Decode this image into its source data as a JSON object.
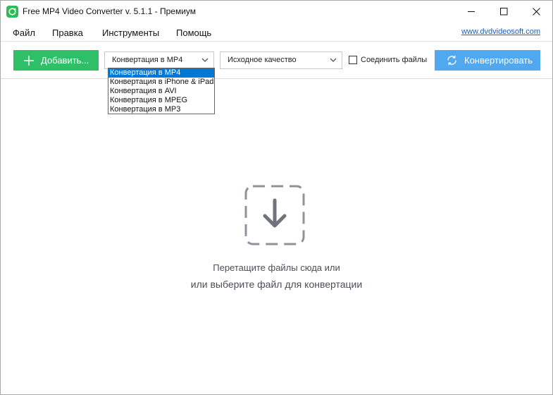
{
  "window": {
    "title": "Free MP4 Video Converter v. 5.1.1 - Премиум"
  },
  "menu": {
    "items": [
      "Файл",
      "Правка",
      "Инструменты",
      "Помощь"
    ],
    "site_link": "www.dvdvideosoft.com"
  },
  "toolbar": {
    "add_label": "Добавить...",
    "format_value": "Конвертация в MP4",
    "quality_value": "Исходное качество",
    "join_label": "Соединить файлы",
    "convert_label": "Конвертировать"
  },
  "format_dropdown": {
    "options": [
      "Конвертация в MP4",
      "Конвертация в iPhone & iPad",
      "Конвертация в AVI",
      "Конвертация в MPEG",
      "Конвертация в MP3"
    ],
    "selected_index": 0
  },
  "drop_area": {
    "line1": "Перетащите файлы сюда или",
    "line2": "или выберите файл для конвертации",
    "icon": "download-arrow-icon"
  },
  "colors": {
    "add_button": "#2ebf67",
    "convert_button": "#4fa8f0",
    "selection": "#0078d7",
    "app_icon": "#2dbb57"
  }
}
